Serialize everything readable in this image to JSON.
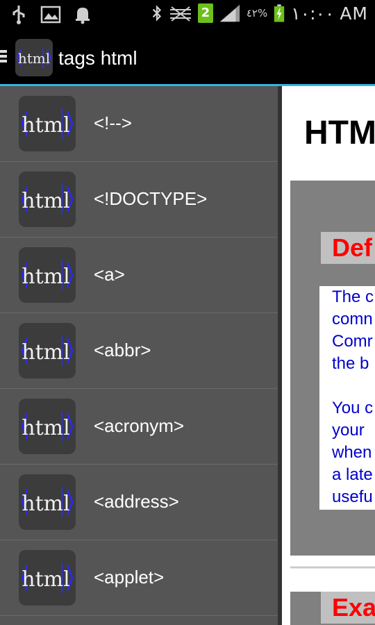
{
  "status_bar": {
    "time": "١٠:٠٠ AM",
    "battery_percent": "٤٢%",
    "notification_badge": "2",
    "icons": [
      "usb-icon",
      "image-icon",
      "notification-bell-icon",
      "bluetooth-icon",
      "no-signal-icon",
      "signal-icon",
      "battery-charging-icon"
    ]
  },
  "action_bar": {
    "title": "tags html",
    "logo_text": "html",
    "icons": [
      "menu-icon",
      "app-logo-icon"
    ]
  },
  "drawer": {
    "items": [
      {
        "label": "<!-->",
        "icon": "html-logo-icon"
      },
      {
        "label": "<!DOCTYPE>",
        "icon": "html-logo-icon"
      },
      {
        "label": "<a>",
        "icon": "html-logo-icon"
      },
      {
        "label": "<abbr>",
        "icon": "html-logo-icon"
      },
      {
        "label": "<acronym>",
        "icon": "html-logo-icon"
      },
      {
        "label": "<address>",
        "icon": "html-logo-icon"
      },
      {
        "label": "<applet>",
        "icon": "html-logo-icon"
      }
    ]
  },
  "content": {
    "heading": "HTM",
    "section1_title": "Def",
    "section1_lines": [
      "The c",
      "comn",
      "Comr",
      "the b",
      "",
      "You c",
      "your",
      "when",
      "a late",
      "usefu"
    ],
    "section2_title": "Exa"
  },
  "colors": {
    "accent": "#33b5e5",
    "drawer_bg": "#555555",
    "section_title": "#ff0000",
    "body_text": "#0000cc"
  }
}
